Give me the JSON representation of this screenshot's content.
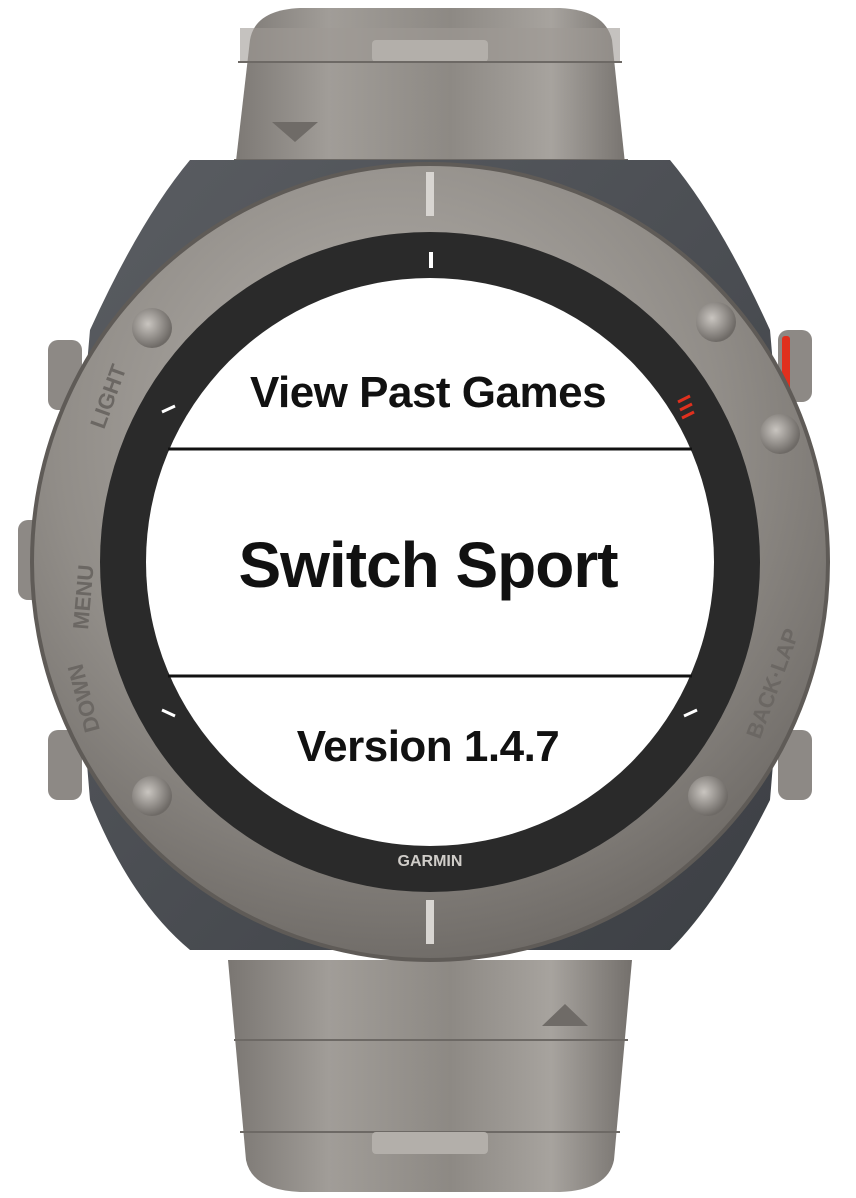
{
  "device": {
    "brand": "GARMIN",
    "bezel_labels": {
      "light": "LIGHT",
      "menu": "MENU",
      "down": "DOWN",
      "back_lap": "BACK·LAP"
    }
  },
  "menu": {
    "items": [
      {
        "label": "View Past Games"
      },
      {
        "label": "Switch Sport"
      },
      {
        "label": "Version 1.4.7"
      }
    ],
    "selected_index": 1
  },
  "colors": {
    "screen_background": "#ffffff",
    "text": "#111111",
    "divider": "#111111",
    "accent_red": "#e0301e",
    "bezel": "#8e8a85",
    "case": "#4c4f54"
  }
}
